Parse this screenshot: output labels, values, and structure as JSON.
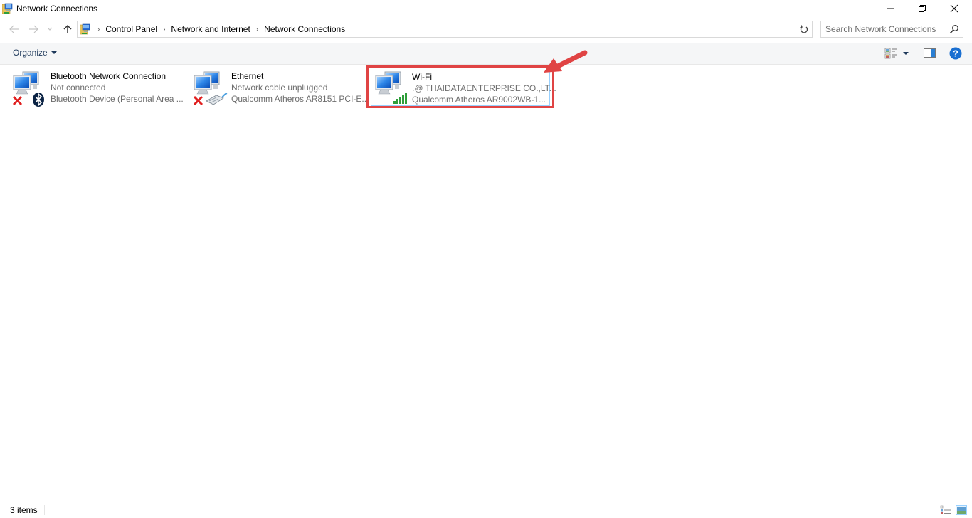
{
  "window": {
    "title": "Network Connections",
    "app_icon": "network-connections-icon",
    "controls": {
      "minimize": "minimize-icon",
      "maximize": "restore-icon",
      "close": "close-icon"
    }
  },
  "navigation": {
    "back_icon": "arrow-left-icon",
    "forward_icon": "arrow-right-icon",
    "recent_icon": "chevron-down-icon",
    "up_icon": "arrow-up-icon",
    "breadcrumbs": [
      "Control Panel",
      "Network and Internet",
      "Network Connections"
    ],
    "refresh_icon": "refresh-icon"
  },
  "search": {
    "placeholder": "Search Network Connections",
    "value": ""
  },
  "command_bar": {
    "organize_label": "Organize",
    "view_icon": "change-view-icon",
    "preview_icon": "preview-pane-icon",
    "help_icon": "help-icon"
  },
  "connections": [
    {
      "name": "Bluetooth Network Connection",
      "status": "Not connected",
      "device": "Bluetooth Device (Personal Area ...",
      "badge": "bluetooth-icon",
      "state": "disconnected"
    },
    {
      "name": "Ethernet",
      "status": "Network cable unplugged",
      "device": "Qualcomm Atheros AR8151 PCI-E...",
      "badge": "ethernet-cable-icon",
      "state": "disconnected"
    },
    {
      "name": "Wi-Fi",
      "status": ".@ THAIDATAENTERPRISE CO.,LT...",
      "device": "Qualcomm Atheros AR9002WB-1...",
      "badge": "wifi-signal-icon",
      "state": "connected",
      "selected": true
    }
  ],
  "annotation": {
    "color": "#e04444"
  },
  "status_bar": {
    "item_count": "3 items"
  }
}
